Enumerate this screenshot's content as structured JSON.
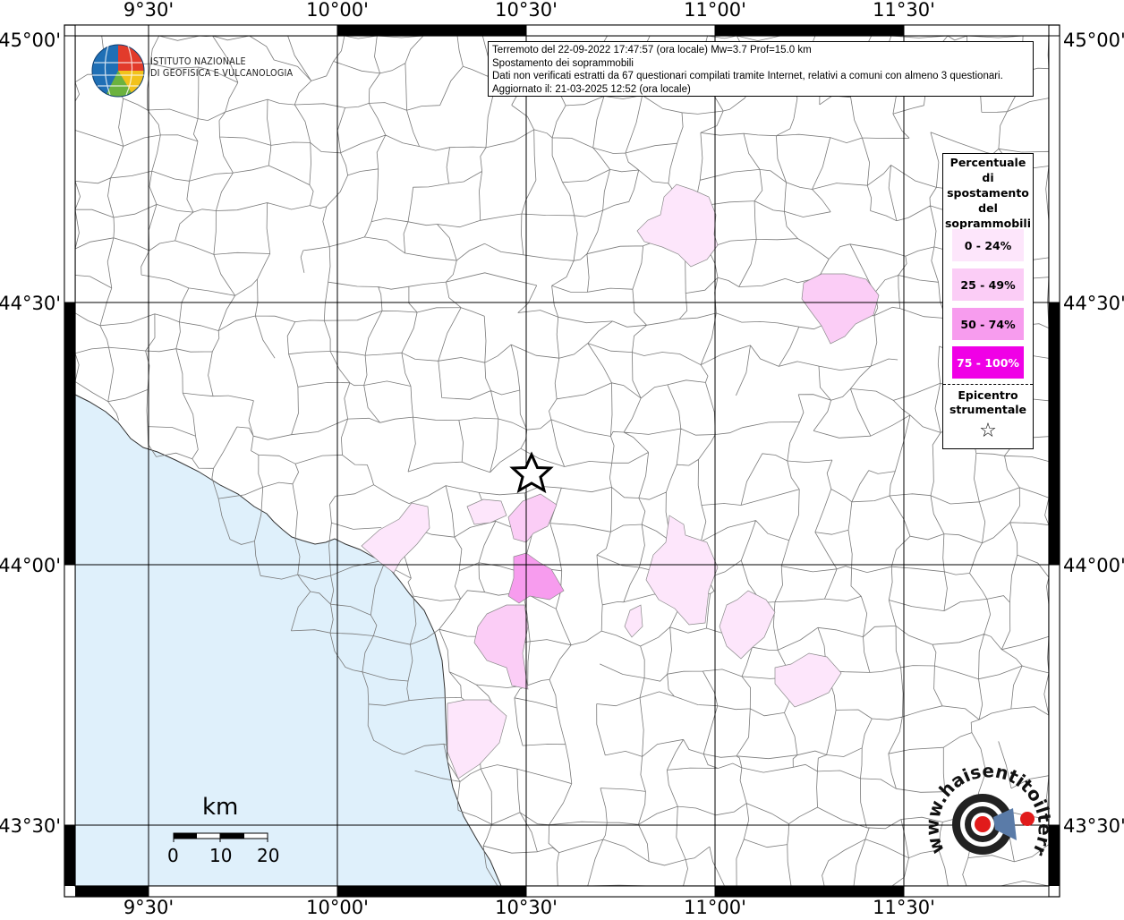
{
  "header": {
    "line1": "Terremoto del 22-09-2022 17:47:57 (ora locale) Mw=3.7 Prof=15.0 km",
    "line2": "Spostamento dei soprammobili",
    "line3": "Dati non verificati estratti da 67 questionari compilati tramite Internet, relativi a comuni con almeno 3 questionari.",
    "line4": "Aggiornato il: 21-03-2025 12:52 (ora locale)"
  },
  "logo": {
    "line1": "ISTITUTO NAZIONALE",
    "line2": "DI GEOFISICA E VULCANOLOGIA"
  },
  "axes": {
    "lon_labels": [
      "9°30'",
      "10°00'",
      "10°30'",
      "11°00'",
      "11°30'"
    ],
    "lat_labels": [
      "45°00'",
      "44°30'",
      "44°00'",
      "43°30'"
    ]
  },
  "legend": {
    "title": "Percentuale di spostamento del soprammobili",
    "items": [
      {
        "label": "0 - 24%",
        "color": "#fde6fb"
      },
      {
        "label": "25 - 49%",
        "color": "#fbcdf6"
      },
      {
        "label": "50 - 74%",
        "color": "#f79cee"
      },
      {
        "label": "75 - 100%",
        "color": "#f000e6"
      }
    ],
    "epicenter_label": "Epicentro strumentale",
    "epicenter_icon": "star-outline"
  },
  "scale": {
    "unit": "km",
    "ticks": [
      "0",
      "10",
      "20"
    ]
  },
  "watermark": {
    "text": "www.haisentitoilterremoto.it"
  },
  "colors": {
    "sea": "#dff0fb",
    "grid": "#000000",
    "borders": "#6e6e6e"
  }
}
